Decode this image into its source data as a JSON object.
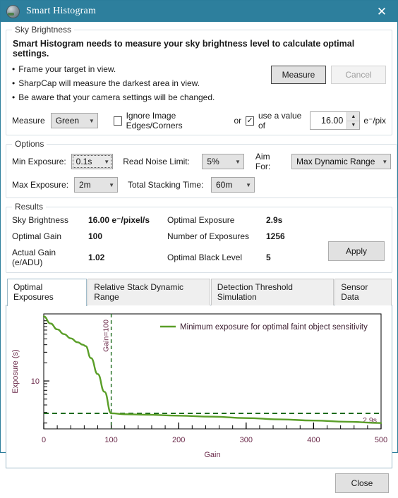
{
  "window": {
    "title": "Smart Histogram",
    "close_glyph": "✕",
    "icon": "planet-icon",
    "titlebar_color": "#2d7f9d"
  },
  "sky_brightness": {
    "legend": "Sky Brightness",
    "headline": "Smart Histogram needs to measure your sky brightness level to calculate optimal settings.",
    "bullets": [
      "Frame your target in view.",
      "SharpCap will measure the darkest area in view.",
      "Be aware that your camera settings will be changed."
    ],
    "measure_button": "Measure",
    "cancel_button": "Cancel",
    "measure_label": "Measure",
    "measure_channel": "Green",
    "ignore_edges_label": "Ignore Image Edges/Corners",
    "ignore_edges_checked": false,
    "or_label": "or",
    "use_value_label": "use a value of",
    "use_value_checked": true,
    "value": "16.00",
    "value_units": "e⁻/pix"
  },
  "options": {
    "legend": "Options",
    "min_exposure_label": "Min Exposure:",
    "min_exposure_value": "0.1s",
    "read_noise_label": "Read Noise Limit:",
    "read_noise_value": "5%",
    "aim_for_label": "Aim For:",
    "aim_for_value": "Max Dynamic Range",
    "max_exposure_label": "Max Exposure:",
    "max_exposure_value": "2m",
    "stacking_time_label": "Total Stacking Time:",
    "stacking_time_value": "60m"
  },
  "results": {
    "legend": "Results",
    "sky_brightness_label": "Sky Brightness",
    "sky_brightness_value": "16.00 e⁻/pixel/s",
    "optimal_exposure_label": "Optimal Exposure",
    "optimal_exposure_value": "2.9s",
    "optimal_gain_label": "Optimal Gain",
    "optimal_gain_value": "100",
    "num_exposures_label": "Number of Exposures",
    "num_exposures_value": "1256",
    "actual_gain_label": "Actual Gain (e/ADU)",
    "actual_gain_value": "1.02",
    "black_level_label": "Optimal Black Level",
    "black_level_value": "5",
    "apply_button": "Apply"
  },
  "tabs": [
    {
      "label": "Optimal Exposures",
      "active": true
    },
    {
      "label": "Relative Stack Dynamic Range",
      "active": false
    },
    {
      "label": "Detection Threshold Simulation",
      "active": false
    },
    {
      "label": "Sensor Data",
      "active": false
    }
  ],
  "footer": {
    "close_button": "Close"
  },
  "chart_data": {
    "type": "line",
    "title": "",
    "xlabel": "Gain",
    "ylabel": "Exposure (s)",
    "xlim": [
      0,
      500
    ],
    "xticks": [
      0,
      100,
      200,
      300,
      400,
      500
    ],
    "xtick_labels": [
      "0",
      "100",
      "200",
      "300",
      "400",
      "500"
    ],
    "yscale": "log",
    "ylim": [
      1.6,
      130
    ],
    "yticks": [
      10
    ],
    "ytick_labels": [
      "10"
    ],
    "grid": false,
    "legend_position": "top-right",
    "series": [
      {
        "name": "Minimum exposure for optimal faint object sensitivity",
        "color": "#5a9e28",
        "x": [
          0,
          10,
          20,
          30,
          40,
          50,
          58,
          62,
          70,
          80,
          90,
          100,
          120,
          150,
          200,
          250,
          300,
          350,
          400,
          450,
          500
        ],
        "y": [
          118,
          90,
          72,
          60,
          51,
          44,
          40,
          38,
          24,
          13,
          6.6,
          2.9,
          2.8,
          2.75,
          2.65,
          2.55,
          2.42,
          2.3,
          2.2,
          2.1,
          2.0
        ]
      }
    ],
    "annotations": [
      {
        "type": "vline",
        "label": "Gain=100",
        "x": 100,
        "color": "#1d6b1d",
        "style": "dashed"
      },
      {
        "type": "hline",
        "label": "2.9s",
        "y": 2.9,
        "color": "#1d6b1d",
        "style": "dashed"
      }
    ],
    "legend_entries": [
      {
        "label": "Minimum exposure for optimal faint object sensitivity",
        "color": "#5a9e28"
      }
    ],
    "axis_label_color": "#6b2a4a",
    "tick_label_color": "#6b2a4a"
  }
}
